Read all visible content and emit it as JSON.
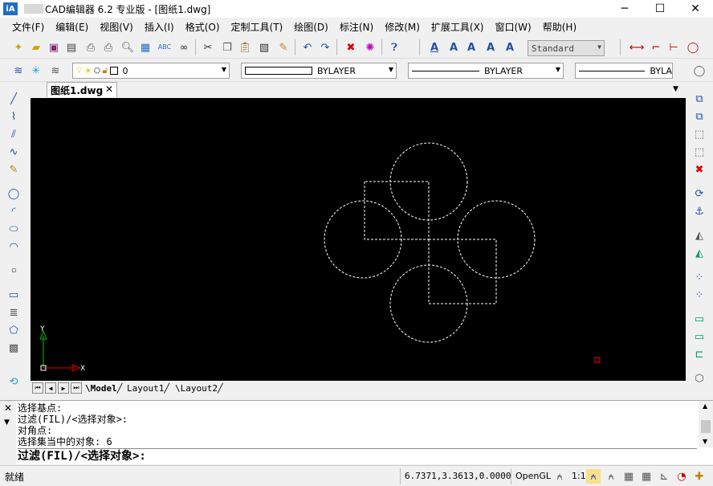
{
  "title": {
    "app_name": "CAD编辑器 6.2 专业版",
    "document": "  - [图纸1.dwg]"
  },
  "window_controls": {
    "minimize": "─",
    "maximize": "☐",
    "close": "✕"
  },
  "menu": [
    "文件(F)",
    "编辑(E)",
    "视图(V)",
    "插入(I)",
    "格式(O)",
    "定制工具(T)",
    "绘图(D)",
    "标注(N)",
    "修改(M)",
    "扩展工具(X)",
    "窗口(W)",
    "帮助(H)"
  ],
  "toolbar": {
    "text_style": "Standard",
    "layer": "0",
    "color": "BYLAYER",
    "linetype": "BYLAYER",
    "lineweight": "BYLA"
  },
  "document_tab": {
    "label": "图纸1.dwg",
    "close": "✕"
  },
  "canvas": {
    "background": "#000000",
    "axis_y": "Y",
    "axis_x": "X"
  },
  "layout_tabs": [
    "Model",
    "Layout1",
    "Layout2"
  ],
  "command": {
    "history": [
      "选择基点:",
      "过滤(FIL)/<选择对象>:",
      "对角点:",
      "选择集当中的对象: 6"
    ],
    "prompt": "过滤(FIL)/<选择对象>:"
  },
  "status": {
    "text": "就绪",
    "coords": "6.7371,3.3613,0.0000",
    "renderer": "OpenGL",
    "scale": "1:1"
  },
  "colors": {
    "selection": "#ffffff",
    "axis_y": "#00c000",
    "axis_x": "#e00000",
    "grip": "#ff0000"
  }
}
